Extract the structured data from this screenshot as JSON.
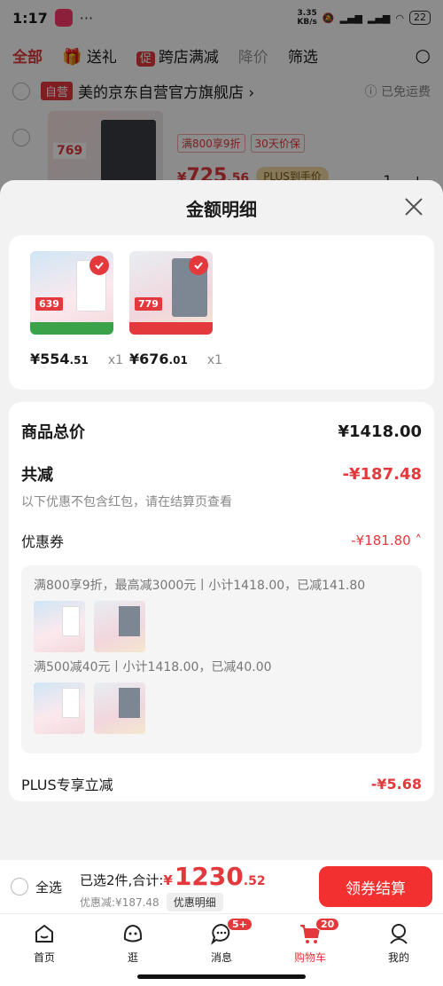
{
  "status_bar": {
    "time": "1:17",
    "speed_value": "3.35",
    "speed_unit": "KB/s",
    "battery": "22"
  },
  "filter_bar": {
    "all": "全部",
    "gift": "送礼",
    "promo_badge": "促",
    "cross_store": "跨店满减",
    "price_drop": "降价",
    "filter": "筛选"
  },
  "store": {
    "self_badge": "自营",
    "name": "美的京东自营官方旗舰店",
    "chevron": "›",
    "shipping": "ⓘ 已免运费"
  },
  "bg_product": {
    "thumb_price": "769",
    "tags": [
      "满800享9折",
      "30天价保"
    ],
    "price_symbol": "¥",
    "price_int": "725",
    "price_dec": ".56",
    "plus_badge": "PLUS到手价",
    "quantity": "1",
    "minus": "−",
    "plus": "+"
  },
  "sheet": {
    "title": "金额明细",
    "items": [
      {
        "tag": "639",
        "symbol": "¥",
        "price_int": "554",
        "price_dec": ".51",
        "qty": "x1"
      },
      {
        "tag": "779",
        "symbol": "¥",
        "price_int": "676",
        "price_dec": ".01",
        "qty": "x1"
      }
    ],
    "total_label": "商品总价",
    "total_value": "¥1418.00",
    "reduce_label": "共减",
    "reduce_value": "-¥187.48",
    "reduce_note": "以下优惠不包含红包，请在结算页查看",
    "coupon_label": "优惠券",
    "coupon_value": "-¥181.80",
    "coupon_rules": [
      "满800享9折，最高减3000元丨小计1418.00，已减141.80",
      "满500减40元丨小计1418.00，已减40.00"
    ],
    "plus_label": "PLUS专享立减",
    "plus_value": "-¥5.68"
  },
  "action_bar": {
    "select_all": "全选",
    "selected_prefix": "已选2件,合计:",
    "currency": "¥",
    "total_int": "1230",
    "total_dec": ".52",
    "discount": "优惠减:¥187.48",
    "detail": "优惠明细",
    "checkout": "领券结算"
  },
  "tabs": [
    {
      "label": "首页",
      "icon": "home-icon"
    },
    {
      "label": "逛",
      "icon": "explore-icon"
    },
    {
      "label": "消息",
      "icon": "message-icon",
      "badge": "5+"
    },
    {
      "label": "购物车",
      "icon": "cart-icon",
      "badge": "20",
      "active": true
    },
    {
      "label": "我的",
      "icon": "profile-icon"
    }
  ],
  "colors": {
    "accent": "#e4393c",
    "checkout": "#f23030"
  }
}
